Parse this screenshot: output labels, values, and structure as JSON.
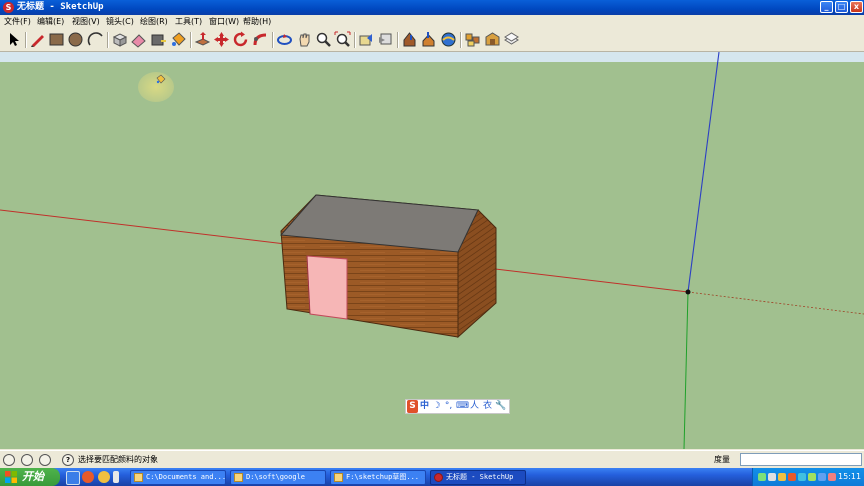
{
  "window": {
    "title": "无标题 - SketchUp",
    "minimize": "_",
    "maximize": "□",
    "close": "x"
  },
  "menu": [
    "文件(F)",
    "编辑(E)",
    "视图(V)",
    "镜头(C)",
    "绘图(R)",
    "工具(T)",
    "窗口(W)",
    "帮助(H)"
  ],
  "toolbar_tools": [
    "select",
    "line",
    "rectangle",
    "circle",
    "arc",
    "make-component",
    "eraser",
    "tape-measure",
    "paint-bucket",
    "push-pull",
    "move",
    "rotate",
    "follow-me",
    "offset",
    "orbit",
    "pan",
    "zoom",
    "zoom-extents",
    "previous-view",
    "next-view",
    "get-models",
    "share-model",
    "get-photo-texture",
    "extension-warehouse",
    "toggle-terrain",
    "section-plane",
    "add-location"
  ],
  "ime_bar": {
    "items": [
      "S",
      "中",
      "☽",
      "°,",
      "⌨",
      "人",
      "衣",
      "🔧"
    ]
  },
  "status": {
    "text": "选择要匹配颜料的对象",
    "help_icon": "?",
    "measure_label": "度量",
    "measure_value": ""
  },
  "taskbar": {
    "start_label": "开始",
    "tasks": [
      {
        "label": "C:\\Documents and..."
      },
      {
        "label": "D:\\soft\\google"
      },
      {
        "label": "F:\\sketchup草图..."
      },
      {
        "label": "无标题 - SketchUp"
      }
    ],
    "clock": "15:11"
  },
  "colors": {
    "ground": "#a1c08f",
    "sky": "#d5e6ee",
    "red_axis": "#c0302a",
    "blue_axis": "#2c3fc4",
    "green_axis": "#1fa02a",
    "roof": "#7d7a76",
    "wood": "#9c5a26",
    "door": "#f6b6b6"
  }
}
